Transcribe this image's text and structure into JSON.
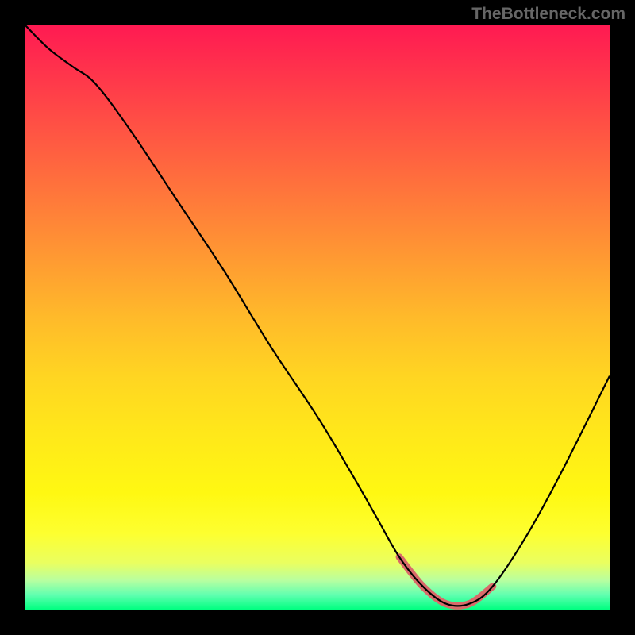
{
  "watermark": "TheBottleneck.com",
  "chart_data": {
    "type": "line",
    "title": "",
    "xlabel": "",
    "ylabel": "",
    "xlim": [
      0,
      100
    ],
    "ylim": [
      0,
      100
    ],
    "grid": false,
    "series": [
      {
        "name": "curve",
        "x": [
          0,
          4,
          8,
          12,
          18,
          26,
          34,
          42,
          50,
          56,
          60,
          64,
          68,
          72,
          76,
          80,
          86,
          92,
          100
        ],
        "values": [
          100,
          96,
          93,
          90,
          82,
          70,
          58,
          45,
          33,
          23,
          16,
          9,
          4,
          1,
          1,
          4,
          13,
          24,
          40
        ]
      }
    ],
    "annotations": [
      {
        "name": "highlight-bump",
        "type": "range",
        "x_start": 64,
        "x_end": 78,
        "color": "#d96a6a"
      }
    ],
    "background": {
      "type": "vertical-gradient",
      "stops": [
        {
          "pos": 0,
          "color": "#ff1a52"
        },
        {
          "pos": 50,
          "color": "#ffba2a"
        },
        {
          "pos": 85,
          "color": "#fdff30"
        },
        {
          "pos": 100,
          "color": "#00ff80"
        }
      ]
    }
  }
}
